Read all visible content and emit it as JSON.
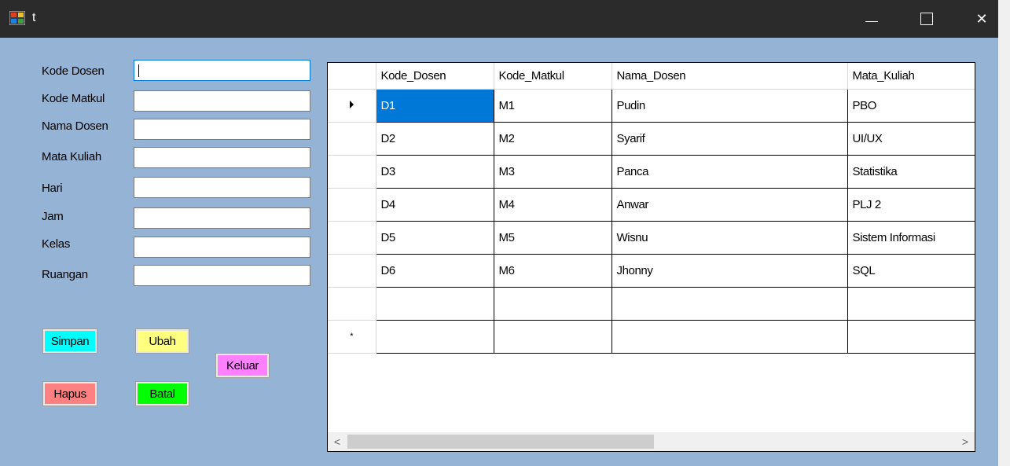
{
  "window": {
    "title": "t",
    "icon": "form-app-icon",
    "controls": {
      "minimize": "minimize-icon",
      "maximize": "maximize-icon",
      "close": "close-icon",
      "close_glyph": "✕"
    }
  },
  "form": {
    "fields": [
      {
        "label": "Kode Dosen",
        "value": "",
        "focused": true
      },
      {
        "label": "Kode Matkul",
        "value": ""
      },
      {
        "label": "Nama Dosen",
        "value": ""
      },
      {
        "label": "Mata Kuliah",
        "value": ""
      },
      {
        "label": "Hari",
        "value": ""
      },
      {
        "label": "Jam",
        "value": ""
      },
      {
        "label": "Kelas",
        "value": ""
      },
      {
        "label": "Ruangan",
        "value": ""
      }
    ]
  },
  "buttons": {
    "simpan": {
      "label": "Simpan",
      "color": "#00ffff"
    },
    "ubah": {
      "label": "Ubah",
      "color": "#ffff80"
    },
    "keluar": {
      "label": "Keluar",
      "color": "#ff80ff"
    },
    "hapus": {
      "label": "Hapus",
      "color": "#ff8080"
    },
    "batal": {
      "label": "Batal",
      "color": "#00ff00"
    }
  },
  "grid": {
    "columns": [
      "Kode_Dosen",
      "Kode_Matkul",
      "Nama_Dosen",
      "Mata_Kuliah"
    ],
    "rows": [
      [
        "D1",
        "M1",
        "Pudin",
        "PBO"
      ],
      [
        "D2",
        "M2",
        "Syarif",
        "UI/UX"
      ],
      [
        "D3",
        "M3",
        "Panca",
        "Statistika"
      ],
      [
        "D4",
        "M4",
        "Anwar",
        "PLJ 2"
      ],
      [
        "D5",
        "M5",
        "Wisnu",
        "Sistem Informasi"
      ],
      [
        "D6",
        "M6",
        "Jhonny",
        "SQL"
      ],
      [
        "",
        "",
        "",
        ""
      ]
    ],
    "new_row_marker": "*",
    "selected_color": "#0078d7",
    "scroll_left": "<",
    "scroll_right": ">"
  }
}
